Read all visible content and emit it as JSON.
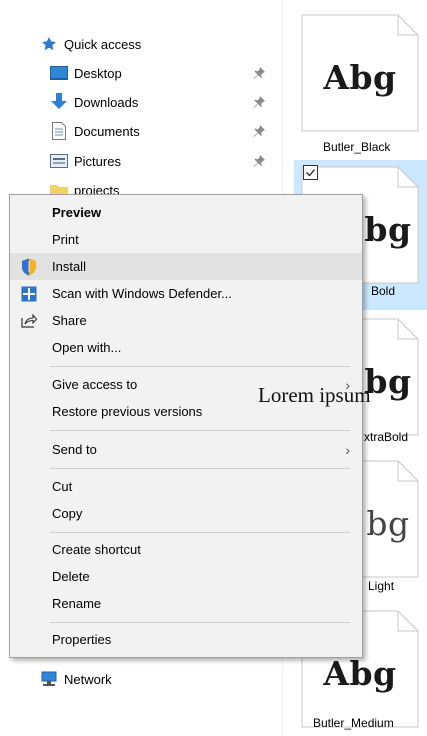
{
  "nav": {
    "quick_access": "Quick access",
    "items": [
      {
        "label": "Desktop",
        "icon": "desktop-icon",
        "pinned": true
      },
      {
        "label": "Downloads",
        "icon": "downloads-arrow-icon",
        "pinned": true
      },
      {
        "label": "Documents",
        "icon": "documents-icon",
        "pinned": true
      },
      {
        "label": "Pictures",
        "icon": "pictures-icon",
        "pinned": true
      },
      {
        "label": "projects",
        "icon": "folder-icon",
        "pinned": false
      }
    ],
    "network": "Network"
  },
  "files": [
    {
      "name": "Butler_Black",
      "preview": "Abg",
      "selected": false
    },
    {
      "name": "Butler_Bold",
      "preview": "Abg",
      "selected": true,
      "visible_name": "Bold",
      "visible_preview": "bg"
    },
    {
      "name": "Butler_ExtraBold",
      "preview": "Abg",
      "visible_name": "xtraBold",
      "visible_preview": "bg"
    },
    {
      "name": "Butler_Light",
      "preview": "Abg",
      "visible_name": "Light",
      "visible_preview": "bg"
    },
    {
      "name": "Butler_Medium",
      "preview": "Abg"
    }
  ],
  "context_menu": {
    "items": [
      {
        "label": "Preview",
        "bold": true
      },
      {
        "label": "Print"
      },
      {
        "label": "Install",
        "icon": "shield-icon",
        "hover": true
      },
      {
        "label": "Scan with Windows Defender...",
        "icon": "defender-icon"
      },
      {
        "label": "Share",
        "icon": "share-icon"
      },
      {
        "label": "Open with..."
      },
      {
        "label": "Give access to",
        "submenu": true
      },
      {
        "label": "Restore previous versions"
      },
      {
        "label": "Send to",
        "submenu": true
      },
      {
        "label": "Cut"
      },
      {
        "label": "Copy"
      },
      {
        "label": "Create shortcut"
      },
      {
        "label": "Delete"
      },
      {
        "label": "Rename"
      },
      {
        "label": "Properties"
      }
    ],
    "submenu_arrow": "›"
  },
  "overlay_text": "Lorem ipsum",
  "colors": {
    "selection": "#cce8ff",
    "menu_bg": "#f2f2f2",
    "menu_hover": "#e2e2e2",
    "menu_border": "#a0a0a0",
    "quick_access_star": "#2b79d0",
    "downloads_blue": "#2f7fd6",
    "desktop_blue": "#2f86d7",
    "folder_yellow": "#f3d26b"
  }
}
